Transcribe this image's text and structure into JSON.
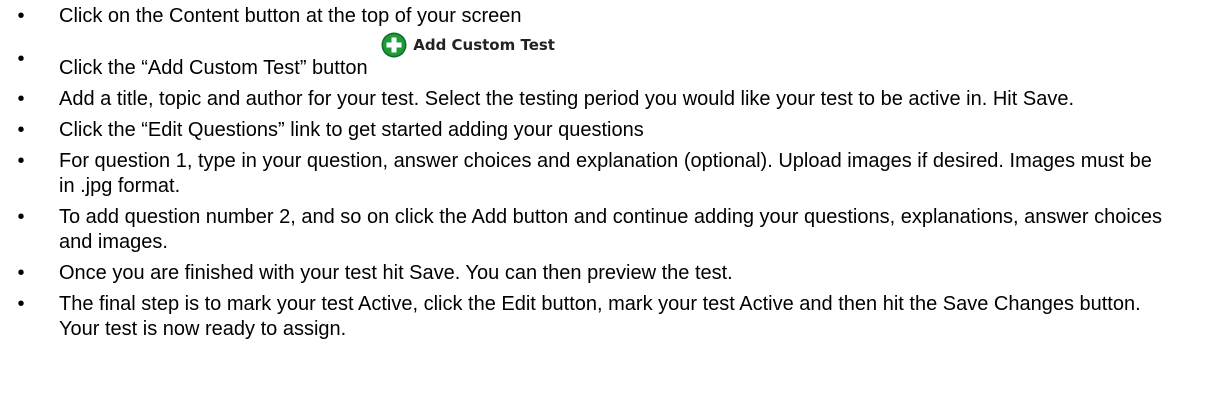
{
  "instructions": {
    "bullet_char": "•",
    "items": [
      {
        "text": "Click on the Content button at the top of your screen"
      },
      {
        "text": "Click the “Add Custom Test” button",
        "button_label": "Add Custom Test",
        "button_icon": "plus-circle-icon"
      },
      {
        "text": "Add a title, topic and author for your test.  Select the testing period you would like your test to be active in.  Hit Save."
      },
      {
        "text": "Click the “Edit Questions” link to get started adding your questions"
      },
      {
        "text": "For question 1, type in your question, answer choices and explanation (optional).  Upload images if desired.  Images must be in .jpg format."
      },
      {
        "text": "To add question number 2, and so on click the Add button and continue adding your questions, explanations, answer choices and images."
      },
      {
        "text": "Once you are finished with your test hit Save.  You can then preview the test."
      },
      {
        "text": "The final step is to mark your test Active, click the Edit button, mark your test Active and then hit the Save Changes button.  Your test is now ready to assign."
      }
    ]
  },
  "colors": {
    "icon_green": "#1f9a3a",
    "icon_dark_green": "#0e6b24",
    "text": "#000000"
  }
}
